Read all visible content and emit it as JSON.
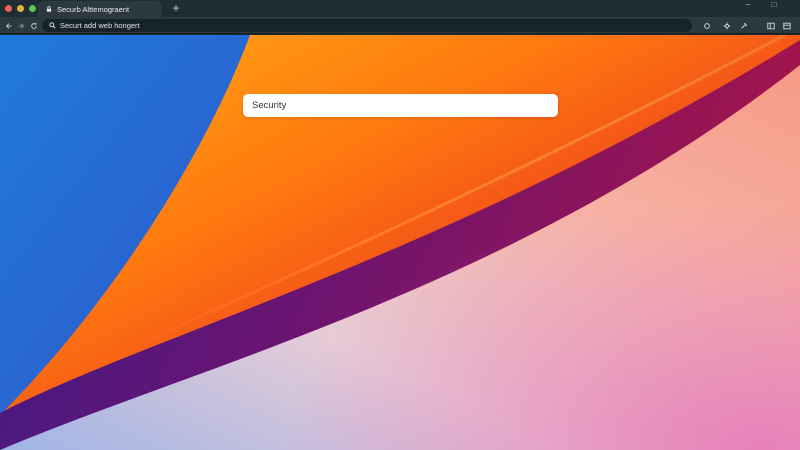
{
  "window": {
    "tab_title": "Securb Alttemograent",
    "new_tab_label": "+",
    "controls": {
      "minimize": "–",
      "maximize": "□"
    }
  },
  "toolbar": {
    "address_text": "Securt add web hongert"
  },
  "page": {
    "search_value": "Security"
  },
  "colors": {
    "chrome_bg": "#1f2c31",
    "tab_bg": "#2c3a40",
    "dot_close": "#e8645a",
    "dot_min": "#e6b43c",
    "dot_max": "#5fc24e"
  }
}
